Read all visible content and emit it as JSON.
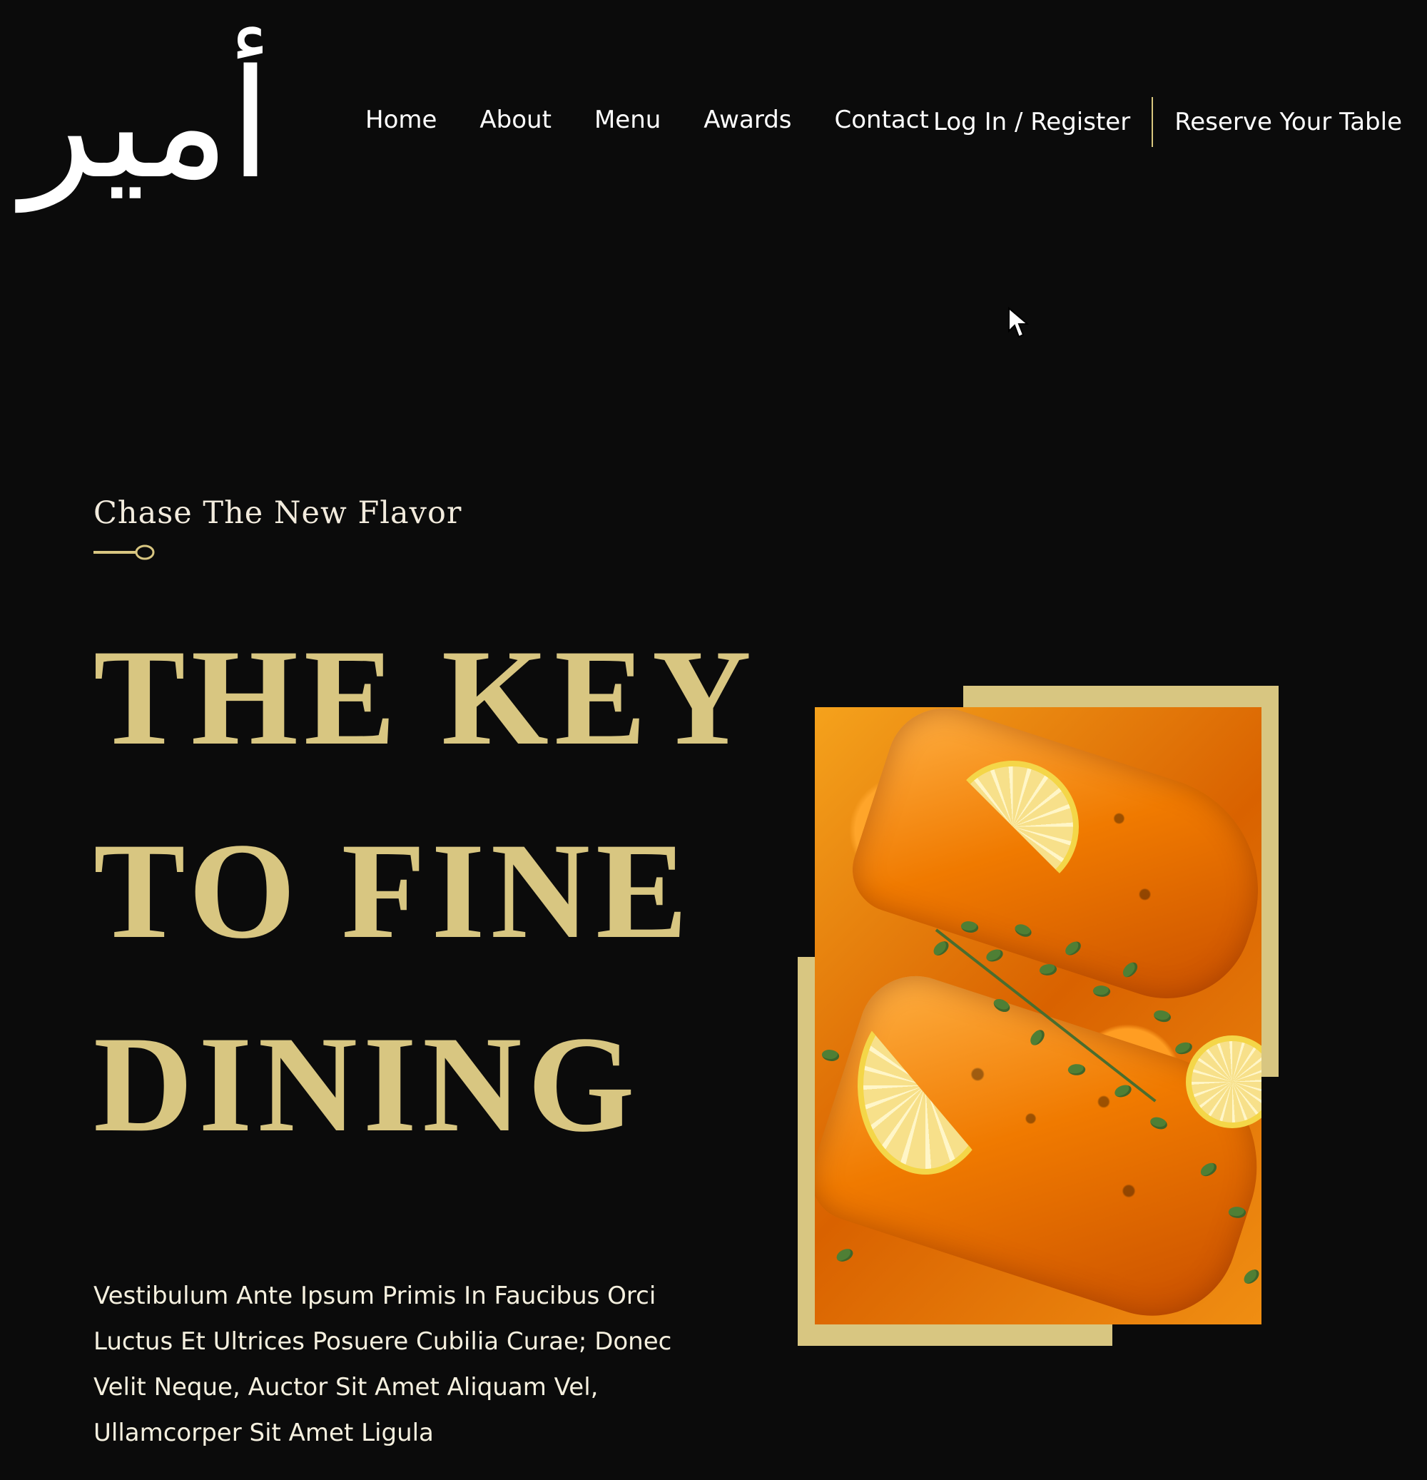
{
  "brand": {
    "logo_text": "أمير"
  },
  "nav": {
    "items": [
      {
        "label": "Home"
      },
      {
        "label": "About"
      },
      {
        "label": "Menu"
      },
      {
        "label": "Awards"
      },
      {
        "label": "Contact"
      }
    ]
  },
  "account": {
    "login_label": "Log In / Register",
    "reserve_label": "Reserve Your Table"
  },
  "hero": {
    "subtitle": "Chase The New Flavor",
    "title_lines": [
      "THE KEY",
      "TO FINE",
      "DINING"
    ],
    "body": "Vestibulum Ante Ipsum Primis In Faucibus Orci Luctus Et Ultrices Posuere Cubilia Curae; Donec Velit Neque, Auctor Sit Amet Aliquam Vel, Ullamcorper Sit Amet Ligula"
  },
  "colors": {
    "background": "#0b0b0b",
    "accent": "#d8c681",
    "text": "#ffffff"
  },
  "icons": {
    "cursor": "mouse-pointer-icon",
    "ornament": "spoon-divider-icon"
  }
}
